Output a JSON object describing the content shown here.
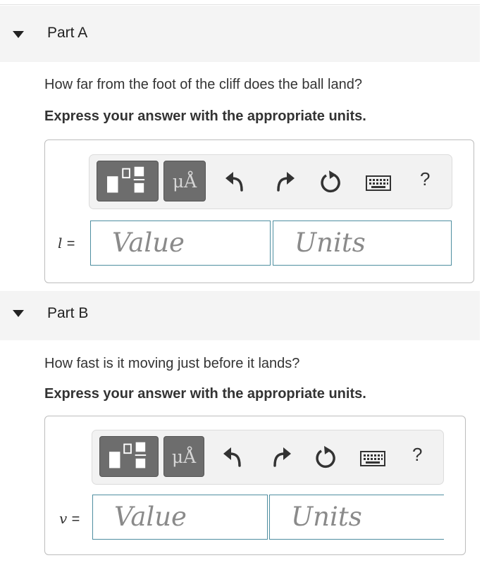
{
  "parts": [
    {
      "title": "Part A",
      "question": "How far from the foot of the cliff does the ball land?",
      "instruction": "Express your answer with the appropriate units.",
      "variable": "l",
      "equals": "=",
      "value_placeholder": "Value",
      "units_placeholder": "Units",
      "help": "?",
      "units_button": "μÅ"
    },
    {
      "title": "Part B",
      "question": "How fast is it moving just before it lands?",
      "instruction": "Express your answer with the appropriate units.",
      "variable": "v",
      "equals": "=",
      "value_placeholder": "Value",
      "units_placeholder": "Units",
      "help": "?",
      "units_button": "μÅ"
    }
  ],
  "icons": [
    "templates-icon",
    "undo-icon",
    "redo-icon",
    "reset-icon",
    "keyboard-icon",
    "help-icon"
  ],
  "colors": {
    "field_border": "#4e8ea0",
    "button_bg": "#6d6d6d",
    "header_bg": "#f4f4f4"
  }
}
